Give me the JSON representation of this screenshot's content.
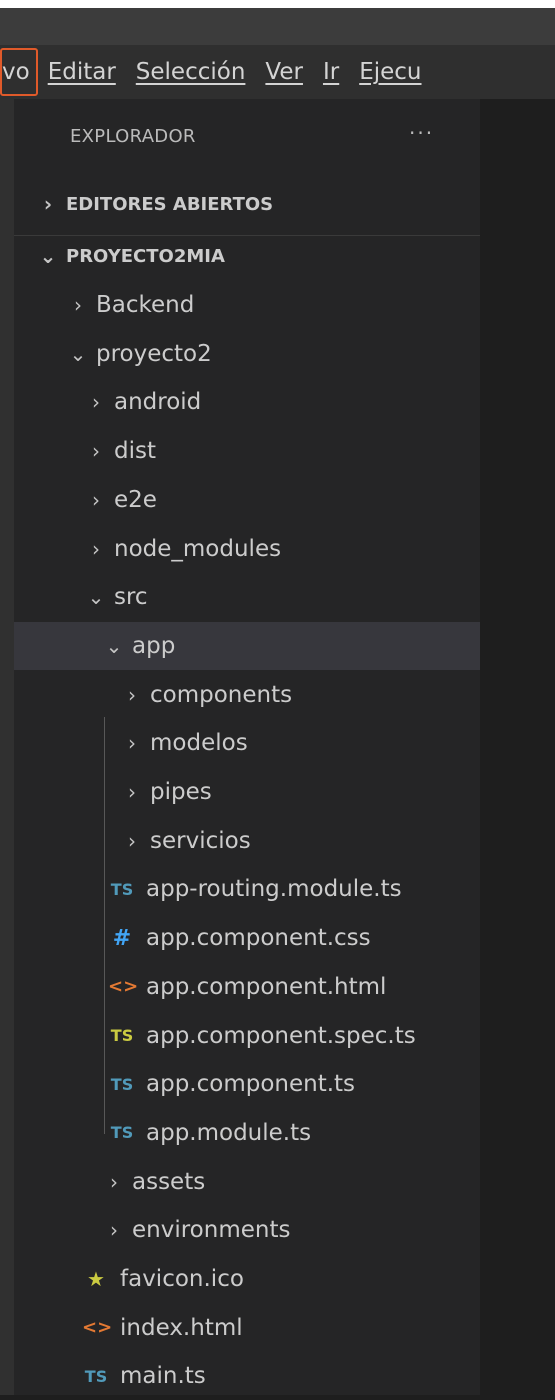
{
  "menu": {
    "items": [
      "vo",
      "Editar",
      "Selección",
      "Ver",
      "Ir",
      "Ejecu"
    ]
  },
  "explorer": {
    "title": "EXPLORADOR",
    "more": "···",
    "sections": {
      "open_editors": "EDITORES ABIERTOS",
      "project": "PROYECTO2MIA"
    },
    "tree": [
      {
        "label": "Backend",
        "type": "folder",
        "open": false,
        "depth": 1
      },
      {
        "label": "proyecto2",
        "type": "folder",
        "open": true,
        "depth": 1
      },
      {
        "label": "android",
        "type": "folder",
        "open": false,
        "depth": 2
      },
      {
        "label": "dist",
        "type": "folder",
        "open": false,
        "depth": 2
      },
      {
        "label": "e2e",
        "type": "folder",
        "open": false,
        "depth": 2
      },
      {
        "label": "node_modules",
        "type": "folder",
        "open": false,
        "depth": 2
      },
      {
        "label": "src",
        "type": "folder",
        "open": true,
        "depth": 2
      },
      {
        "label": "app",
        "type": "folder",
        "open": true,
        "depth": 3,
        "selected": true
      },
      {
        "label": "components",
        "type": "folder",
        "open": false,
        "depth": 4
      },
      {
        "label": "modelos",
        "type": "folder",
        "open": false,
        "depth": 4
      },
      {
        "label": "pipes",
        "type": "folder",
        "open": false,
        "depth": 4
      },
      {
        "label": "servicios",
        "type": "folder",
        "open": false,
        "depth": 4
      },
      {
        "label": "app-routing.module.ts",
        "type": "file",
        "icon": "TS",
        "iconClass": "ts",
        "depth": 4
      },
      {
        "label": "app.component.css",
        "type": "file",
        "icon": "#",
        "iconClass": "css",
        "depth": 4
      },
      {
        "label": "app.component.html",
        "type": "file",
        "icon": "<>",
        "iconClass": "html",
        "depth": 4
      },
      {
        "label": "app.component.spec.ts",
        "type": "file",
        "icon": "TS",
        "iconClass": "ts-spec",
        "depth": 4
      },
      {
        "label": "app.component.ts",
        "type": "file",
        "icon": "TS",
        "iconClass": "ts",
        "depth": 4
      },
      {
        "label": "app.module.ts",
        "type": "file",
        "icon": "TS",
        "iconClass": "ts",
        "depth": 4
      },
      {
        "label": "assets",
        "type": "folder",
        "open": false,
        "depth": 3
      },
      {
        "label": "environments",
        "type": "folder",
        "open": false,
        "depth": 3
      },
      {
        "label": "favicon.ico",
        "type": "file",
        "icon": "★",
        "iconClass": "star",
        "depth": 3
      },
      {
        "label": "index.html",
        "type": "file",
        "icon": "<>",
        "iconClass": "html",
        "depth": 3
      },
      {
        "label": "main.ts",
        "type": "file",
        "icon": "TS",
        "iconClass": "ts",
        "depth": 3
      }
    ]
  }
}
